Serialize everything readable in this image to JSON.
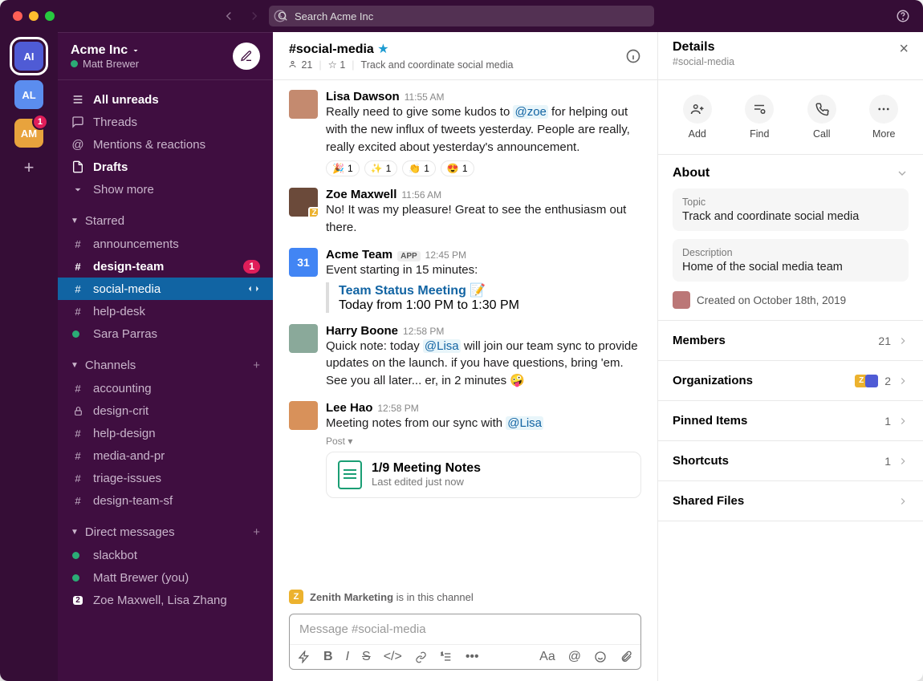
{
  "search_placeholder": "Search Acme Inc",
  "workspaces": [
    {
      "label": "AI",
      "selected": true
    },
    {
      "label": "AL"
    },
    {
      "label": "AM",
      "badge": "1"
    }
  ],
  "sidebar": {
    "title": "Acme Inc",
    "user": "Matt Brewer",
    "nav": [
      {
        "label": "All unreads",
        "bold": true,
        "icon": "unreads"
      },
      {
        "label": "Threads",
        "icon": "threads"
      },
      {
        "label": "Mentions & reactions",
        "icon": "mentions"
      },
      {
        "label": "Drafts",
        "bold": true,
        "icon": "drafts"
      },
      {
        "label": "Show more",
        "icon": "more"
      }
    ],
    "starred_label": "Starred",
    "starred": [
      {
        "label": "announcements",
        "icon": "hash"
      },
      {
        "label": "design-team",
        "icon": "hash",
        "bold": true,
        "badge": "1"
      },
      {
        "label": "social-media",
        "icon": "hash",
        "active": true,
        "swap": true
      },
      {
        "label": "help-desk",
        "icon": "hash"
      },
      {
        "label": "Sara Parras",
        "icon": "presence"
      }
    ],
    "channels_label": "Channels",
    "channels": [
      {
        "label": "accounting",
        "icon": "hash"
      },
      {
        "label": "design-crit",
        "icon": "lock"
      },
      {
        "label": "help-design",
        "icon": "hash"
      },
      {
        "label": "media-and-pr",
        "icon": "hash"
      },
      {
        "label": "triage-issues",
        "icon": "hash"
      },
      {
        "label": "design-team-sf",
        "icon": "hash"
      }
    ],
    "dm_label": "Direct messages",
    "dms": [
      {
        "label": "slackbot",
        "icon": "presence"
      },
      {
        "label": "Matt Brewer (you)",
        "icon": "presence"
      },
      {
        "label": "Zoe Maxwell, Lisa Zhang",
        "icon": "multi"
      }
    ]
  },
  "channel": {
    "name": "#social-media",
    "members": "21",
    "pins": "1",
    "topic": "Track and coordinate social media"
  },
  "messages": [
    {
      "name": "Lisa Dawson",
      "ts": "11:55 AM",
      "body": "Really need to give some kudos to ",
      "mention": "@zoe",
      "body2": " for helping out with the new influx of tweets yesterday. People are really, really excited about yesterday's announcement.",
      "reactions": [
        [
          "🎉",
          "1"
        ],
        [
          "✨",
          "1"
        ],
        [
          "👏",
          "1"
        ],
        [
          "😍",
          "1"
        ]
      ],
      "av": "#c48a6f"
    },
    {
      "name": "Zoe Maxwell",
      "ts": "11:56 AM",
      "body": "No! It was my pleasure! Great to see the enthusiasm out there.",
      "corner": "Z",
      "av": "#6b4a3a"
    },
    {
      "name": "Acme Team",
      "ts": "12:45 PM",
      "app": true,
      "body": "Event starting in 15 minutes:",
      "event_title": "Team Status Meeting",
      "event_time": "Today from 1:00 PM to 1:30 PM",
      "cal": "31"
    },
    {
      "name": "Harry Boone",
      "ts": "12:58 PM",
      "body": "Quick note: today ",
      "mention": "@Lisa",
      "body2": " will join our team sync to provide updates on the launch. if you have questions, bring 'em. See you all later... er, in 2 minutes 🤪",
      "av": "#8aa99a"
    },
    {
      "name": "Lee Hao",
      "ts": "12:58 PM",
      "body": "Meeting notes from our sync with ",
      "mention": "@Lisa",
      "post": true,
      "doc_title": "1/9 Meeting Notes",
      "doc_sub": "Last edited just now",
      "av": "#d8915a"
    }
  ],
  "channel_notice": {
    "org": "Zenith Marketing",
    "text": "is in this channel"
  },
  "composer_placeholder": "Message #social-media",
  "post_label": "Post",
  "details": {
    "title": "Details",
    "sub": "#social-media",
    "actions": [
      {
        "l": "Add",
        "i": "add"
      },
      {
        "l": "Find",
        "i": "find"
      },
      {
        "l": "Call",
        "i": "call"
      },
      {
        "l": "More",
        "i": "more"
      }
    ],
    "about": "About",
    "topic_l": "Topic",
    "topic_v": "Track and coordinate social media",
    "desc_l": "Description",
    "desc_v": "Home of the social media team",
    "created": "Created on October 18th, 2019",
    "rows": [
      {
        "l": "Members",
        "v": "21"
      },
      {
        "l": "Organizations",
        "v": "2",
        "orgs": true
      },
      {
        "l": "Pinned Items",
        "v": "1"
      },
      {
        "l": "Shortcuts",
        "v": "1"
      },
      {
        "l": "Shared Files"
      }
    ]
  }
}
